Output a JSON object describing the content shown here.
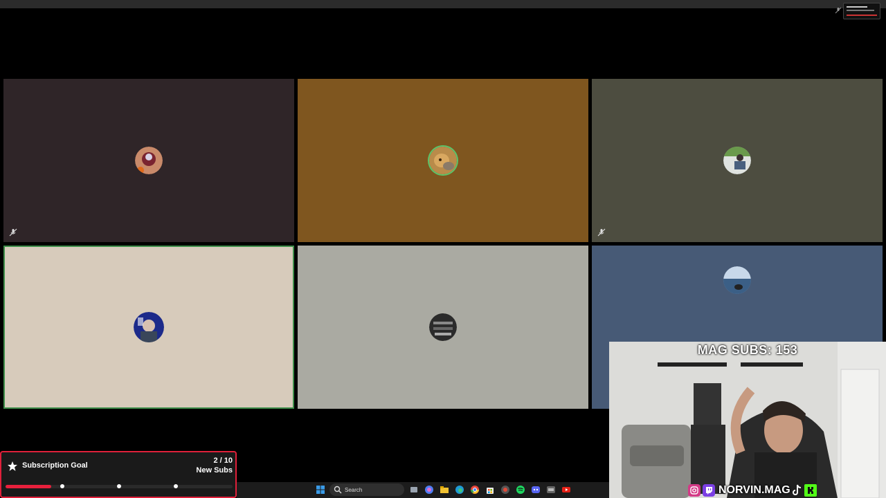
{
  "overlay": {
    "subs_counter": "MAG SUBS: 153",
    "social_handle": "NORVIN.MAG",
    "social_icons": [
      "instagram-icon",
      "twitch-icon",
      "tiktok-icon",
      "kick-icon"
    ]
  },
  "subscription_goal": {
    "title": "Subscription Goal",
    "count": "2 / 10",
    "unit": "New Subs",
    "progress_fraction": 0.2,
    "milestones_fraction": [
      0.25,
      0.5,
      0.75
    ],
    "accent": "#e8203c"
  },
  "call_grid": {
    "tiles": [
      {
        "id": "p1",
        "bg": "#2f2528",
        "muted": true,
        "speaking": false,
        "avatar": "avatar-red-character"
      },
      {
        "id": "p2",
        "bg": "#7f561f",
        "muted": false,
        "speaking": true,
        "avatar": "avatar-bear"
      },
      {
        "id": "p3",
        "bg": "#4d4d40",
        "muted": true,
        "speaking": false,
        "avatar": "avatar-person-outdoors"
      },
      {
        "id": "p4",
        "bg": "#d7cbbb",
        "muted": false,
        "speaking": true,
        "avatar": "avatar-person-blue"
      },
      {
        "id": "p5",
        "bg": "#aaaaa2",
        "muted": false,
        "speaking": false,
        "avatar": "avatar-dark-circle"
      },
      {
        "id": "p6",
        "bg": "#475a76",
        "muted": false,
        "speaking": false,
        "avatar": "avatar-lake"
      }
    ]
  },
  "taskbar": {
    "search_label": "Search",
    "icons": [
      "windows-start-icon",
      "task-view-icon",
      "copilot-icon",
      "file-explorer-icon",
      "edge-icon",
      "chrome-icon",
      "store-icon",
      "app-icon",
      "spotify-icon",
      "discord-icon",
      "app-icon-2",
      "youtube-icon"
    ]
  },
  "colors": {
    "page_bg": "#000000",
    "speaking_ring": "#5cc46a",
    "overlay_border": "#e0203a"
  }
}
